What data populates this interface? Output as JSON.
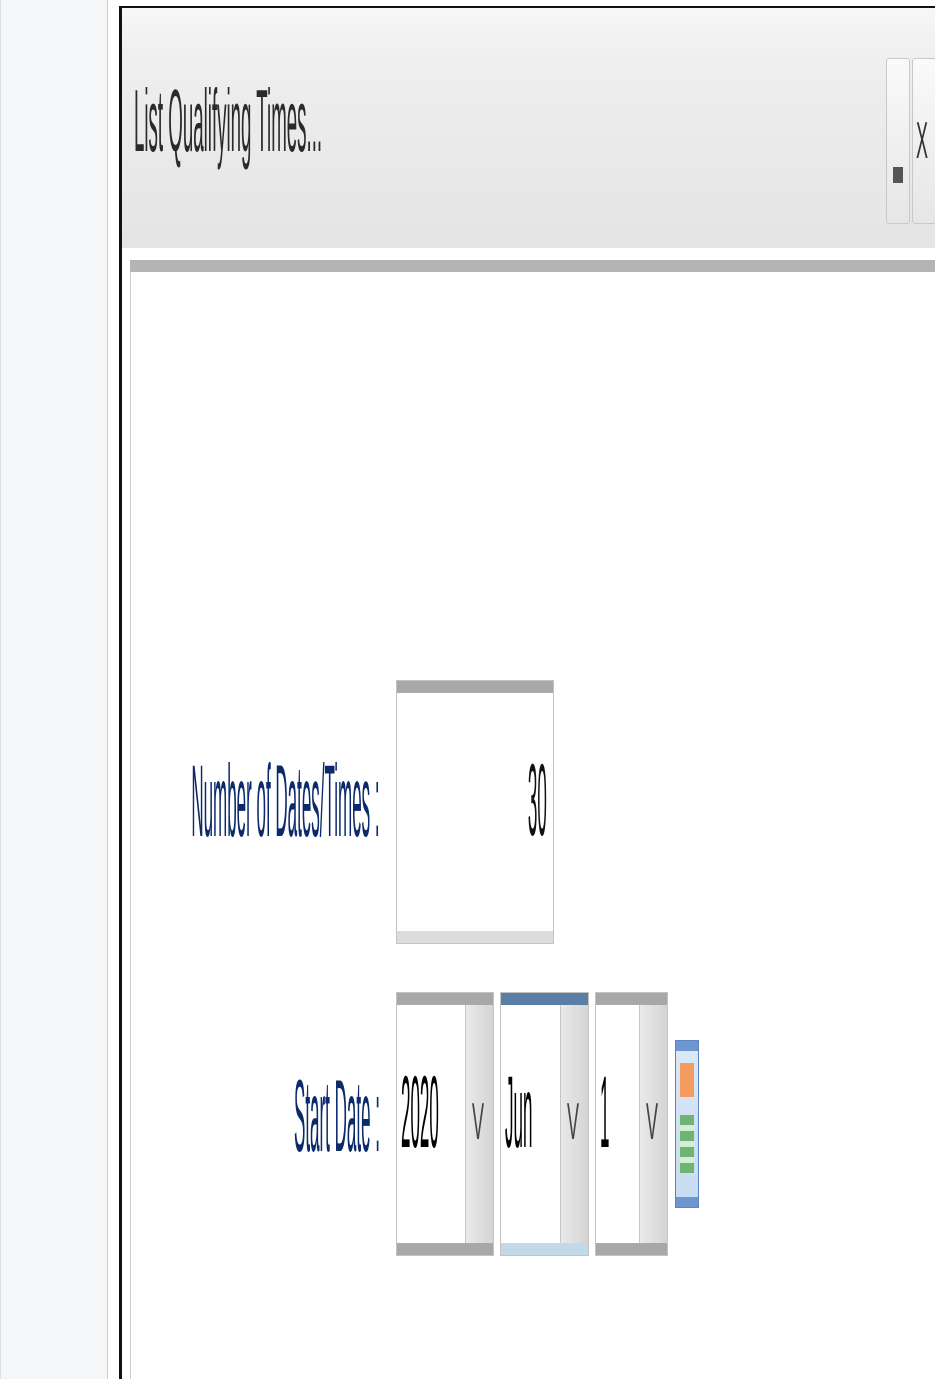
{
  "dialog": {
    "title": "List Qualifying Times...",
    "minimize_glyph": "",
    "close_glyph": "X"
  },
  "form": {
    "number_label": "Number of Dates/Times :",
    "number_value": "30",
    "start_date_label": "Start Date :",
    "year_value": "2020",
    "month_value": "Jun",
    "day_value": "1",
    "dropdown_glyph": "V"
  },
  "icons": {
    "calendar": "calendar-icon",
    "minimize": "minimize-icon",
    "close": "close-icon",
    "dropdown": "chevron-down-icon"
  }
}
